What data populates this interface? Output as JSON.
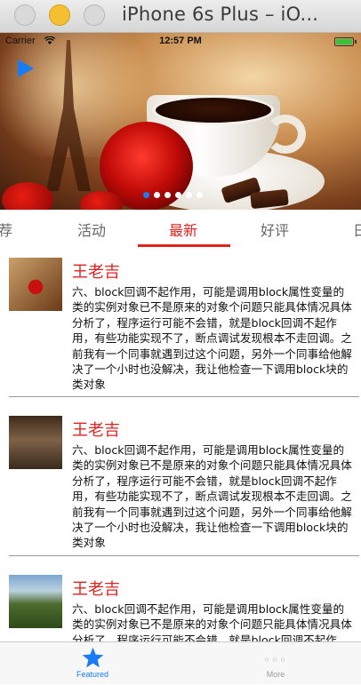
{
  "window": {
    "title": "iPhone 6s Plus – iO..."
  },
  "status_bar": {
    "carrier": "Carrier",
    "time": "12:57 PM"
  },
  "banner": {
    "page_count": 6,
    "active_index": 0
  },
  "tabs": [
    {
      "label": "荐",
      "active": false
    },
    {
      "label": "活动",
      "active": false
    },
    {
      "label": "最新",
      "active": true
    },
    {
      "label": "好评",
      "active": false
    },
    {
      "label": "日",
      "active": false
    }
  ],
  "feed": [
    {
      "name": "王老吉",
      "body": "六、block回调不起作用，可能是调用block属性变量的类的实例对象已不是原来的对象个问题只能具体情况具体分析了，程序运行可能不会错，就是block回调不起作用，有些功能实现不了，断点调试发现根本不走回调。之前我有一个同事就遇到过这个问题，另外一个同事给他解决了一个小时也没解决，我让他检查一下调用block块的类对象"
    },
    {
      "name": "王老吉",
      "body": "六、block回调不起作用，可能是调用block属性变量的类的实例对象已不是原来的对象个问题只能具体情况具体分析了，程序运行可能不会错，就是block回调不起作用，有些功能实现不了，断点调试发现根本不走回调。之前我有一个同事就遇到过这个问题，另外一个同事给他解决了一个小时也没解决，我让他检查一下调用block块的类对象"
    },
    {
      "name": "王老吉",
      "body": "六、block回调不起作用，可能是调用block属性变量的类的实例对象已不是原来的对象个问题只能具体情况具体分析了，程序运行可能不会错，就是block回调不起作用，有些功能实现不了，断点调试发现根本不走回调。之前我有一个同事就遇到过这个问题，另外一个同事给他解决了一个小时也没解决，我让他检查一下调用block块的类对象"
    }
  ],
  "tab_bar": {
    "featured": {
      "label": "Featured",
      "icon": "star-icon",
      "active": true
    },
    "more": {
      "label": "More",
      "icon": "more-icon",
      "active": false
    }
  },
  "colors": {
    "accent_red": "#e0221f",
    "ios_blue": "#1a7cf5"
  }
}
